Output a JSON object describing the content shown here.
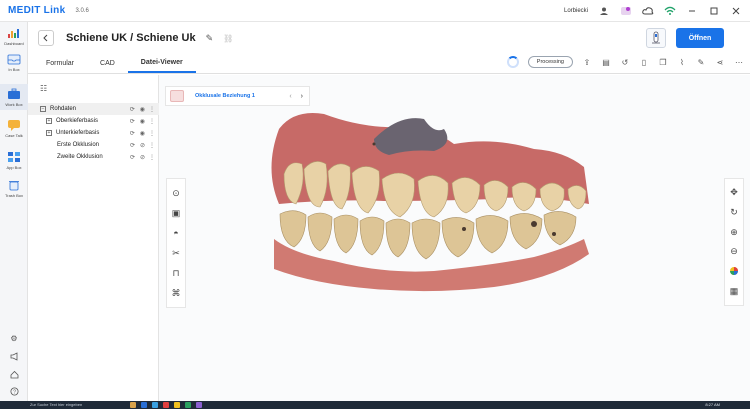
{
  "app": {
    "brand": "MEDIT Link",
    "version": "3.0.6"
  },
  "titlebar": {
    "user": "Lorbiecki",
    "icons": [
      "user-icon",
      "notification-icon",
      "cloud-icon",
      "wifi-icon",
      "minimize-icon",
      "maximize-icon",
      "close-icon"
    ]
  },
  "rail": {
    "items": [
      {
        "label": "Dashboard",
        "icon": "dashboard-icon"
      },
      {
        "label": "In Box",
        "icon": "inbox-icon"
      },
      {
        "label": "Work Box",
        "icon": "workbox-icon"
      },
      {
        "label": "Case Talk",
        "icon": "casetalk-icon"
      },
      {
        "label": "App Box",
        "icon": "appbox-icon"
      },
      {
        "label": "Trash Box",
        "icon": "trash-icon"
      }
    ],
    "bottom_icons": [
      "settings-icon",
      "announce-icon",
      "home-icon",
      "help-icon"
    ]
  },
  "header": {
    "case_title": "Schiene UK / Schiene Uk",
    "open_label": "Öffnen"
  },
  "tabs": [
    {
      "label": "Formular"
    },
    {
      "label": "CAD"
    },
    {
      "label": "Datei-Viewer"
    }
  ],
  "tab_tools": {
    "processing_label": "Processing"
  },
  "tree": {
    "items": [
      {
        "label": "Rohdaten"
      },
      {
        "label": "Oberkieferbasis"
      },
      {
        "label": "Unterkieferbasis"
      },
      {
        "label": "Erste Okklusion"
      },
      {
        "label": "Zweite Okklusion"
      }
    ]
  },
  "viewer": {
    "occlusion_label": "Okklusale Beziehung 1"
  },
  "taskbar": {
    "search_placeholder": "Zur Suche Text hier eingeben",
    "time": "8:27 AM"
  }
}
